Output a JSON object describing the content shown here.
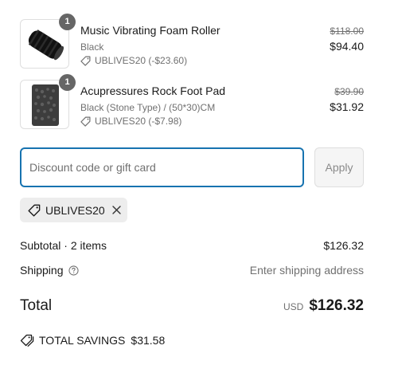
{
  "line_items": [
    {
      "quantity": "1",
      "title": "Music Vibrating Foam Roller",
      "variant": "Black",
      "discount": "UBLIVES20 (-$23.60)",
      "original_price": "$118.00",
      "final_price": "$94.40",
      "image_icon": "foam-roller-image"
    },
    {
      "quantity": "1",
      "title": "Acupressures Rock Foot Pad",
      "variant": "Black (Stone Type) / (50*30)CM",
      "discount": "UBLIVES20 (-$7.98)",
      "original_price": "$39.90",
      "final_price": "$31.92",
      "image_icon": "foot-pad-image"
    }
  ],
  "discount_form": {
    "placeholder": "Discount code or gift card",
    "value": "",
    "apply_label": "Apply"
  },
  "applied_code": {
    "label": "UBLIVES20",
    "icon": "tag-icon",
    "remove_icon": "close-icon"
  },
  "summary": {
    "subtotal_label": "Subtotal · 2 items",
    "subtotal_value": "$126.32",
    "shipping_label": "Shipping",
    "shipping_value": "Enter shipping address",
    "total_label": "Total",
    "currency": "USD",
    "total_value": "$126.32"
  },
  "savings": {
    "label": "TOTAL SAVINGS",
    "value": "$31.58"
  },
  "colors": {
    "accent": "#1773b0",
    "badge": "#666666",
    "muted_text": "#707070",
    "chip_bg": "#ededed"
  }
}
